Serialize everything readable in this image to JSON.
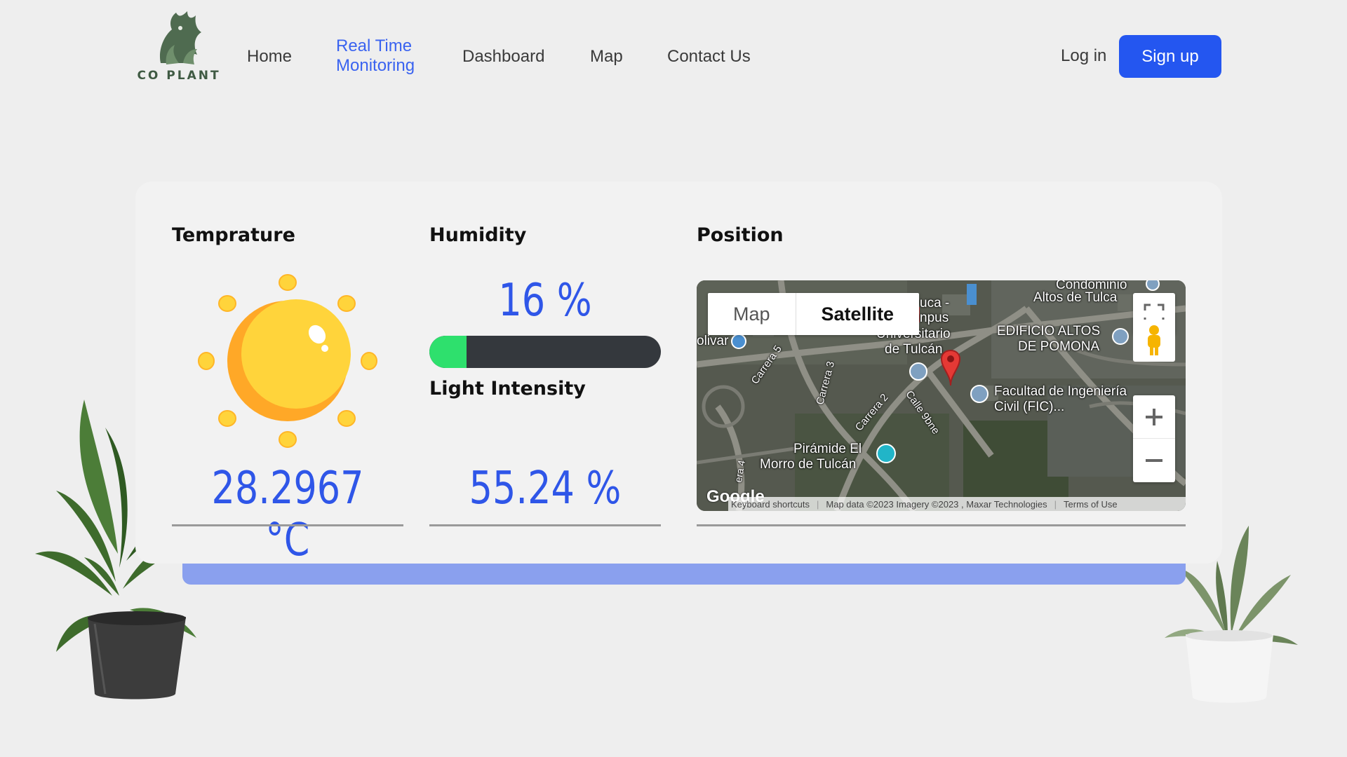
{
  "brand": {
    "name": "CO PLANT"
  },
  "nav": {
    "home": "Home",
    "realtime_line1": "Real Time",
    "realtime_line2": "Monitoring",
    "dashboard": "Dashboard",
    "map": "Map",
    "contact": "Contact Us",
    "login": "Log in",
    "signup": "Sign up"
  },
  "sections": {
    "temperature_title": "Temprature",
    "humidity_title": "Humidity",
    "light_title": "Light Intensity",
    "position_title": "Position"
  },
  "readings": {
    "temperature": "28.2967 °C",
    "humidity": "16 %",
    "humidity_fraction": 0.16,
    "light": "55.24 %"
  },
  "map": {
    "toggle_map": "Map",
    "toggle_satellite": "Satellite",
    "labels": {
      "condominio": "Condominio",
      "altos_tulca": "Altos de Tulca",
      "uca": "uca -",
      "npus": "npus",
      "universitario": "Universitario",
      "de_tulcan": "de Tulcán",
      "edificio1": "EDIFICIO ALTOS",
      "edificio2": "DE POMONA",
      "olivar": "olivar",
      "carrera5": "Carrera 5",
      "carrera3": "Carrera 3",
      "carrera2": "Carrera 2",
      "calle9": "Calle 9bne",
      "facultad1": "Facultad de Ingeniería",
      "facultad2": "Civil (FIC)...",
      "piramide1": "Pirámide El",
      "piramide2": "Morro de Tulcán",
      "carrera4": "era 4"
    },
    "google": "Google",
    "footer_shortcuts": "Keyboard shortcuts",
    "footer_data": "Map data ©2023 Imagery ©2023 , Maxar Technologies",
    "footer_terms": "Terms of Use"
  },
  "colors": {
    "accent": "#2456f0",
    "value_blue": "#2f56e8",
    "progress_fill": "#2ee06d",
    "progress_track": "#34383d"
  }
}
